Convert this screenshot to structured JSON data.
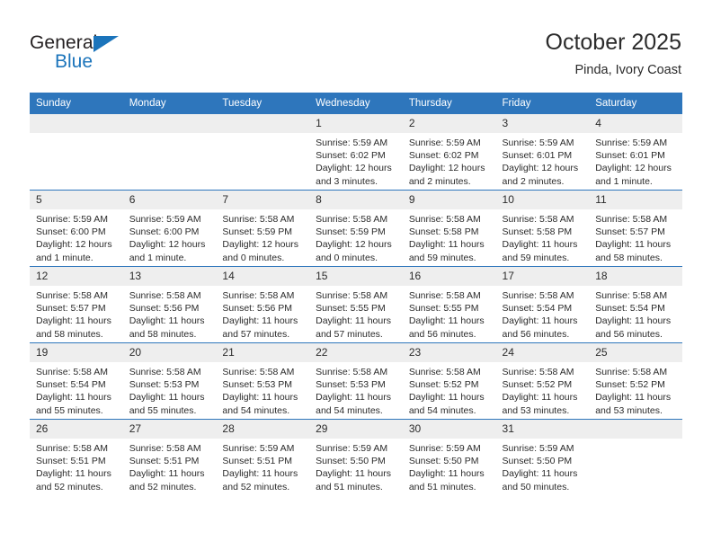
{
  "brand": {
    "name_dark": "General",
    "name_blue": "Blue",
    "accent_color": "#1b74bb"
  },
  "header": {
    "title": "October 2025",
    "subtitle": "Pinda, Ivory Coast"
  },
  "colors": {
    "header_row_bg": "#2e76bc",
    "daynum_bg": "#eeeeee",
    "text": "#2b2b2b"
  },
  "weekday_headers": [
    "Sunday",
    "Monday",
    "Tuesday",
    "Wednesday",
    "Thursday",
    "Friday",
    "Saturday"
  ],
  "weeks": [
    [
      {
        "day": "",
        "empty": true,
        "lines": []
      },
      {
        "day": "",
        "empty": true,
        "lines": []
      },
      {
        "day": "",
        "empty": true,
        "lines": []
      },
      {
        "day": "1",
        "empty": false,
        "lines": [
          "Sunrise: 5:59 AM",
          "Sunset: 6:02 PM",
          "Daylight: 12 hours",
          "and 3 minutes."
        ]
      },
      {
        "day": "2",
        "empty": false,
        "lines": [
          "Sunrise: 5:59 AM",
          "Sunset: 6:02 PM",
          "Daylight: 12 hours",
          "and 2 minutes."
        ]
      },
      {
        "day": "3",
        "empty": false,
        "lines": [
          "Sunrise: 5:59 AM",
          "Sunset: 6:01 PM",
          "Daylight: 12 hours",
          "and 2 minutes."
        ]
      },
      {
        "day": "4",
        "empty": false,
        "lines": [
          "Sunrise: 5:59 AM",
          "Sunset: 6:01 PM",
          "Daylight: 12 hours",
          "and 1 minute."
        ]
      }
    ],
    [
      {
        "day": "5",
        "empty": false,
        "lines": [
          "Sunrise: 5:59 AM",
          "Sunset: 6:00 PM",
          "Daylight: 12 hours",
          "and 1 minute."
        ]
      },
      {
        "day": "6",
        "empty": false,
        "lines": [
          "Sunrise: 5:59 AM",
          "Sunset: 6:00 PM",
          "Daylight: 12 hours",
          "and 1 minute."
        ]
      },
      {
        "day": "7",
        "empty": false,
        "lines": [
          "Sunrise: 5:58 AM",
          "Sunset: 5:59 PM",
          "Daylight: 12 hours",
          "and 0 minutes."
        ]
      },
      {
        "day": "8",
        "empty": false,
        "lines": [
          "Sunrise: 5:58 AM",
          "Sunset: 5:59 PM",
          "Daylight: 12 hours",
          "and 0 minutes."
        ]
      },
      {
        "day": "9",
        "empty": false,
        "lines": [
          "Sunrise: 5:58 AM",
          "Sunset: 5:58 PM",
          "Daylight: 11 hours",
          "and 59 minutes."
        ]
      },
      {
        "day": "10",
        "empty": false,
        "lines": [
          "Sunrise: 5:58 AM",
          "Sunset: 5:58 PM",
          "Daylight: 11 hours",
          "and 59 minutes."
        ]
      },
      {
        "day": "11",
        "empty": false,
        "lines": [
          "Sunrise: 5:58 AM",
          "Sunset: 5:57 PM",
          "Daylight: 11 hours",
          "and 58 minutes."
        ]
      }
    ],
    [
      {
        "day": "12",
        "empty": false,
        "lines": [
          "Sunrise: 5:58 AM",
          "Sunset: 5:57 PM",
          "Daylight: 11 hours",
          "and 58 minutes."
        ]
      },
      {
        "day": "13",
        "empty": false,
        "lines": [
          "Sunrise: 5:58 AM",
          "Sunset: 5:56 PM",
          "Daylight: 11 hours",
          "and 58 minutes."
        ]
      },
      {
        "day": "14",
        "empty": false,
        "lines": [
          "Sunrise: 5:58 AM",
          "Sunset: 5:56 PM",
          "Daylight: 11 hours",
          "and 57 minutes."
        ]
      },
      {
        "day": "15",
        "empty": false,
        "lines": [
          "Sunrise: 5:58 AM",
          "Sunset: 5:55 PM",
          "Daylight: 11 hours",
          "and 57 minutes."
        ]
      },
      {
        "day": "16",
        "empty": false,
        "lines": [
          "Sunrise: 5:58 AM",
          "Sunset: 5:55 PM",
          "Daylight: 11 hours",
          "and 56 minutes."
        ]
      },
      {
        "day": "17",
        "empty": false,
        "lines": [
          "Sunrise: 5:58 AM",
          "Sunset: 5:54 PM",
          "Daylight: 11 hours",
          "and 56 minutes."
        ]
      },
      {
        "day": "18",
        "empty": false,
        "lines": [
          "Sunrise: 5:58 AM",
          "Sunset: 5:54 PM",
          "Daylight: 11 hours",
          "and 56 minutes."
        ]
      }
    ],
    [
      {
        "day": "19",
        "empty": false,
        "lines": [
          "Sunrise: 5:58 AM",
          "Sunset: 5:54 PM",
          "Daylight: 11 hours",
          "and 55 minutes."
        ]
      },
      {
        "day": "20",
        "empty": false,
        "lines": [
          "Sunrise: 5:58 AM",
          "Sunset: 5:53 PM",
          "Daylight: 11 hours",
          "and 55 minutes."
        ]
      },
      {
        "day": "21",
        "empty": false,
        "lines": [
          "Sunrise: 5:58 AM",
          "Sunset: 5:53 PM",
          "Daylight: 11 hours",
          "and 54 minutes."
        ]
      },
      {
        "day": "22",
        "empty": false,
        "lines": [
          "Sunrise: 5:58 AM",
          "Sunset: 5:53 PM",
          "Daylight: 11 hours",
          "and 54 minutes."
        ]
      },
      {
        "day": "23",
        "empty": false,
        "lines": [
          "Sunrise: 5:58 AM",
          "Sunset: 5:52 PM",
          "Daylight: 11 hours",
          "and 54 minutes."
        ]
      },
      {
        "day": "24",
        "empty": false,
        "lines": [
          "Sunrise: 5:58 AM",
          "Sunset: 5:52 PM",
          "Daylight: 11 hours",
          "and 53 minutes."
        ]
      },
      {
        "day": "25",
        "empty": false,
        "lines": [
          "Sunrise: 5:58 AM",
          "Sunset: 5:52 PM",
          "Daylight: 11 hours",
          "and 53 minutes."
        ]
      }
    ],
    [
      {
        "day": "26",
        "empty": false,
        "lines": [
          "Sunrise: 5:58 AM",
          "Sunset: 5:51 PM",
          "Daylight: 11 hours",
          "and 52 minutes."
        ]
      },
      {
        "day": "27",
        "empty": false,
        "lines": [
          "Sunrise: 5:58 AM",
          "Sunset: 5:51 PM",
          "Daylight: 11 hours",
          "and 52 minutes."
        ]
      },
      {
        "day": "28",
        "empty": false,
        "lines": [
          "Sunrise: 5:59 AM",
          "Sunset: 5:51 PM",
          "Daylight: 11 hours",
          "and 52 minutes."
        ]
      },
      {
        "day": "29",
        "empty": false,
        "lines": [
          "Sunrise: 5:59 AM",
          "Sunset: 5:50 PM",
          "Daylight: 11 hours",
          "and 51 minutes."
        ]
      },
      {
        "day": "30",
        "empty": false,
        "lines": [
          "Sunrise: 5:59 AM",
          "Sunset: 5:50 PM",
          "Daylight: 11 hours",
          "and 51 minutes."
        ]
      },
      {
        "day": "31",
        "empty": false,
        "lines": [
          "Sunrise: 5:59 AM",
          "Sunset: 5:50 PM",
          "Daylight: 11 hours",
          "and 50 minutes."
        ]
      },
      {
        "day": "",
        "empty": true,
        "lines": []
      }
    ]
  ]
}
